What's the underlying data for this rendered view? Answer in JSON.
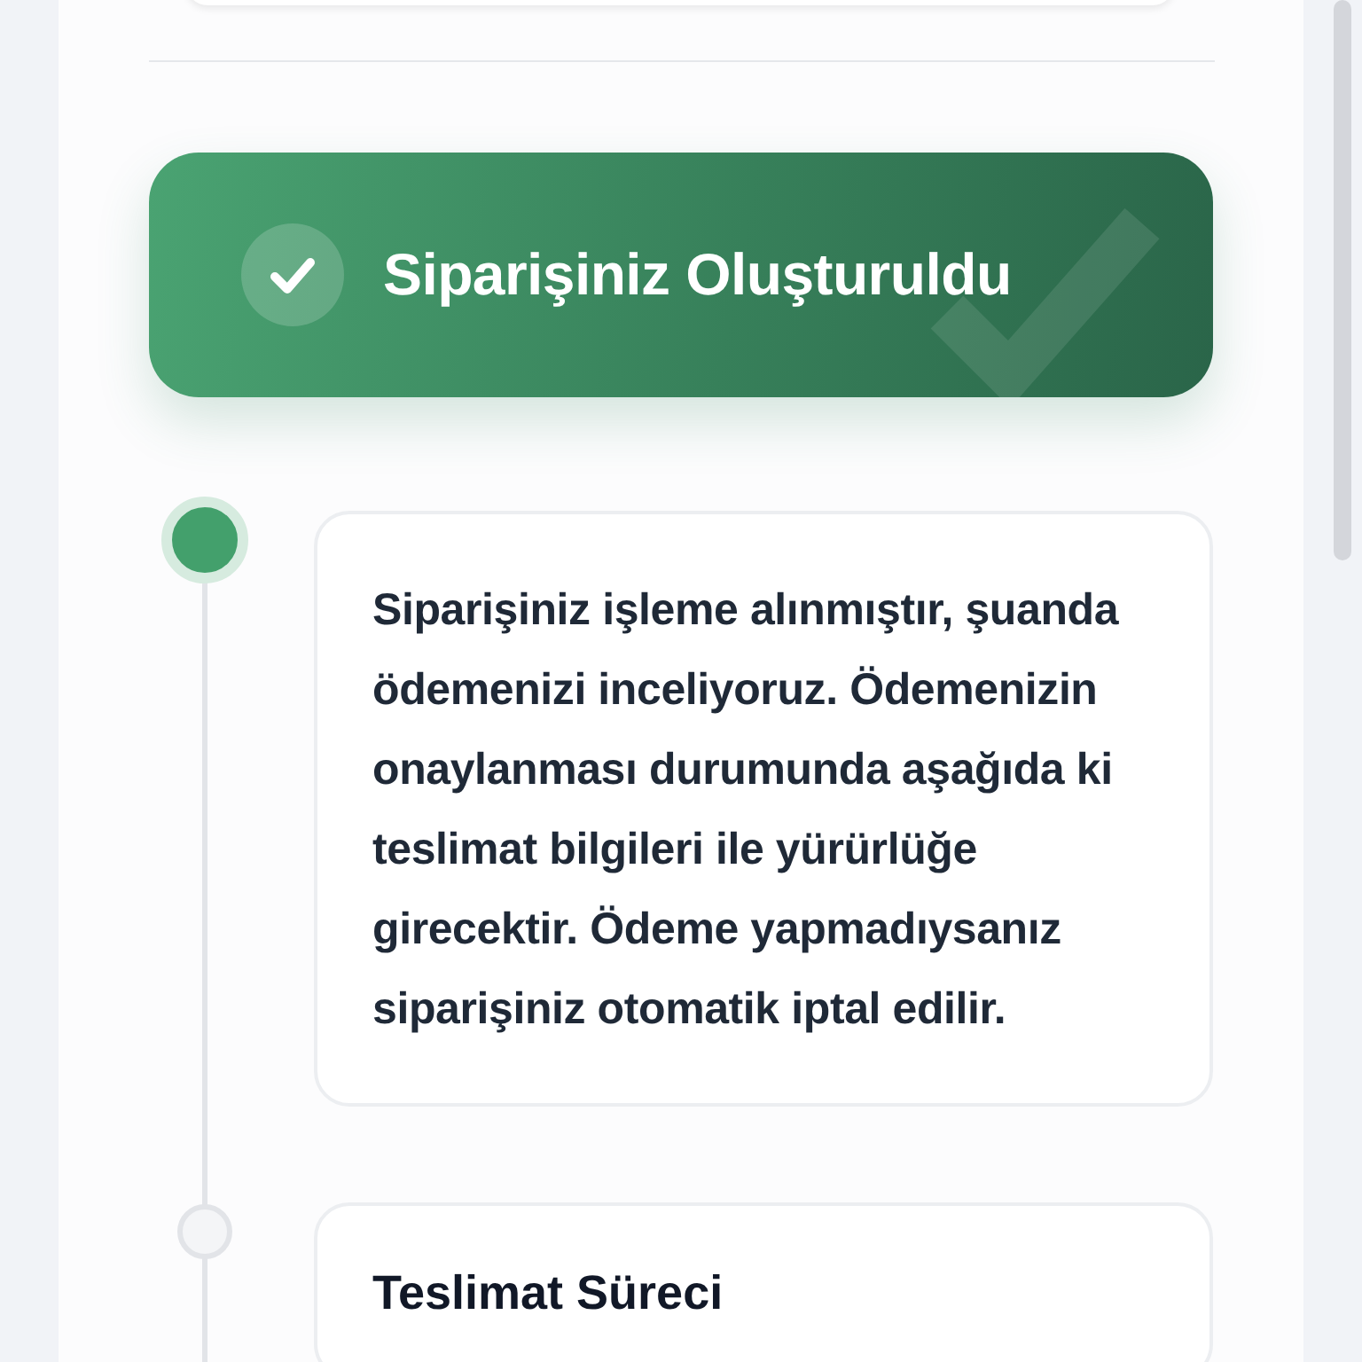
{
  "banner": {
    "title": "Siparişiniz Oluşturuldu"
  },
  "timeline": [
    {
      "kind": "message",
      "active": true,
      "text": "Siparişiniz işleme alınmıştır, şuanda ödemenizi inceliyoruz. Ödemenizin onaylanması durumunda aşağıda ki teslimat bilgileri ile yürürlüğe girecektir. Ödeme yapmadıysanız siparişiniz otomatik iptal edilir."
    },
    {
      "kind": "section",
      "active": false,
      "text": "Teslimat Süreci"
    }
  ]
}
